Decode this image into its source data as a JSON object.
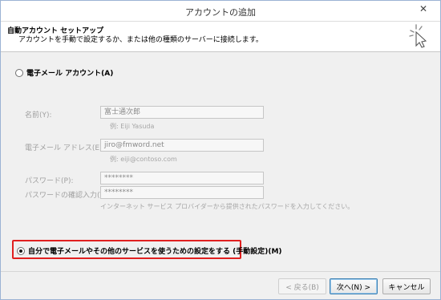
{
  "window": {
    "title": "アカウントの追加",
    "close_label": "✕"
  },
  "header": {
    "title": "自動アカウント セットアップ",
    "subtitle": "アカウントを手動で設定するか、または他の種類のサーバーに接続します。",
    "icon": "wizard-cursor-icon"
  },
  "email_account": {
    "label": "電子メール アカウント(A)",
    "checked": false
  },
  "form": {
    "name": {
      "label": "名前(Y):",
      "value": "富士通次郎",
      "hint": "例: Eiji Yasuda"
    },
    "email": {
      "label": "電子メール アドレス(E):",
      "value": "jiro@fmword.net",
      "hint": "例: eiji@contoso.com"
    },
    "password": {
      "label": "パスワード(P):",
      "value": "********"
    },
    "password_confirm": {
      "label": "パスワードの確認入力(T):",
      "value": "********"
    },
    "password_hint": "インターネット サービス プロバイダーから提供されたパスワードを入力してください。"
  },
  "manual_setup": {
    "label": "自分で電子メールやその他のサービスを使うための設定をする (手動設定)(M)",
    "checked": true
  },
  "buttons": {
    "back": "< 戻る(B)",
    "next": "次へ(N) >",
    "cancel": "キャンセル"
  },
  "colors": {
    "highlight_border": "#e02020",
    "primary_button": "#3c7fb1"
  }
}
